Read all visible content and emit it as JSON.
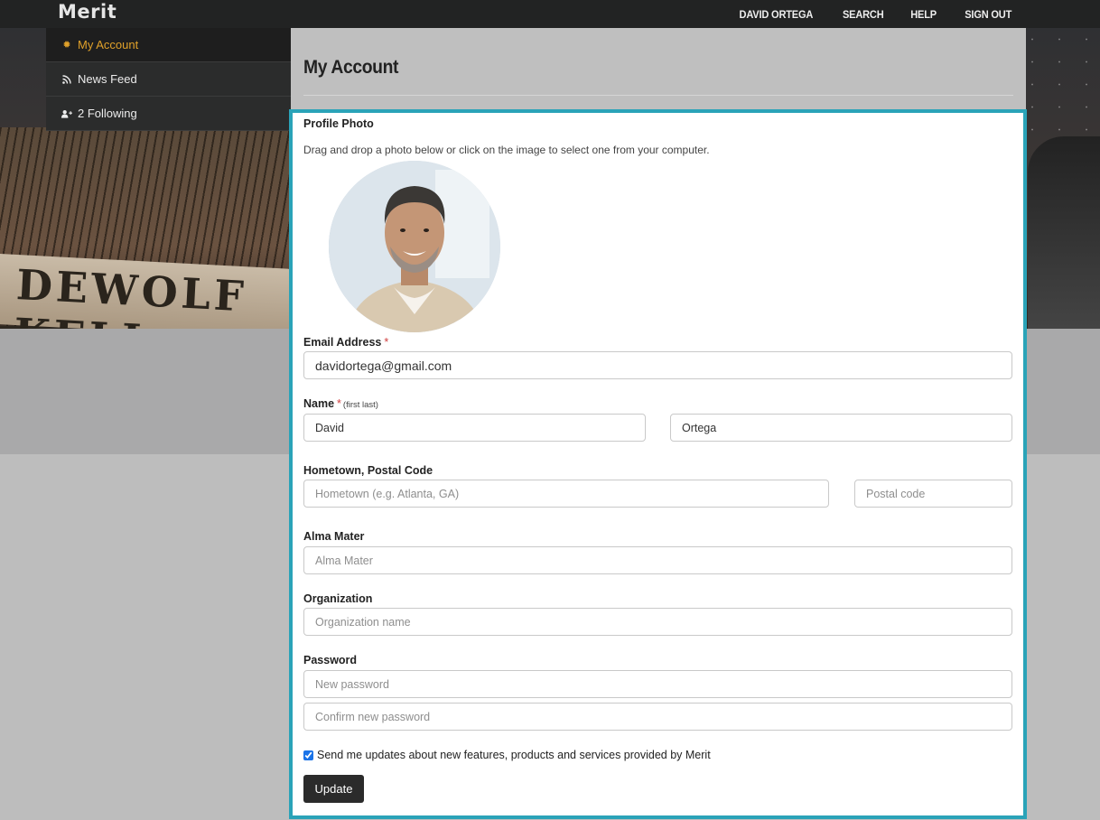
{
  "app": {
    "brand": "Merit"
  },
  "topnav": {
    "user": "DAVID ORTEGA",
    "search": "SEARCH",
    "help": "HELP",
    "signout": "SIGN OUT"
  },
  "hero": {
    "sign_text": "DEWOLF KELL"
  },
  "sidebar": {
    "items": [
      {
        "label": "My Account",
        "icon": "gear-icon",
        "active": true
      },
      {
        "label": "News Feed",
        "icon": "rss-icon",
        "active": false
      },
      {
        "label": "2 Following",
        "icon": "user-plus-icon",
        "active": false
      }
    ]
  },
  "page": {
    "title": "My Account"
  },
  "form": {
    "photo_label": "Profile Photo",
    "photo_hint": "Drag and drop a photo below or click on the image to select one from your computer.",
    "email_label": "Email Address",
    "email_value": "davidortega@gmail.com",
    "required_mark": "*",
    "name_label": "Name",
    "name_hint": "(first last)",
    "first_value": "David",
    "last_value": "Ortega",
    "hometown_label": "Hometown, Postal Code",
    "hometown_placeholder": "Hometown (e.g. Atlanta, GA)",
    "postal_placeholder": "Postal code",
    "alma_label": "Alma Mater",
    "alma_placeholder": "Alma Mater",
    "org_label": "Organization",
    "org_placeholder": "Organization name",
    "password_label": "Password",
    "password_placeholder": "New password",
    "confirm_placeholder": "Confirm new password",
    "updates_label": "Send me updates about new features, products and services provided by Merit",
    "updates_checked": true,
    "submit_label": "Update"
  },
  "colors": {
    "accent": "#2aa3b8",
    "active_nav": "#e0a12a",
    "required": "#d04040",
    "button": "#2b2b2b"
  }
}
